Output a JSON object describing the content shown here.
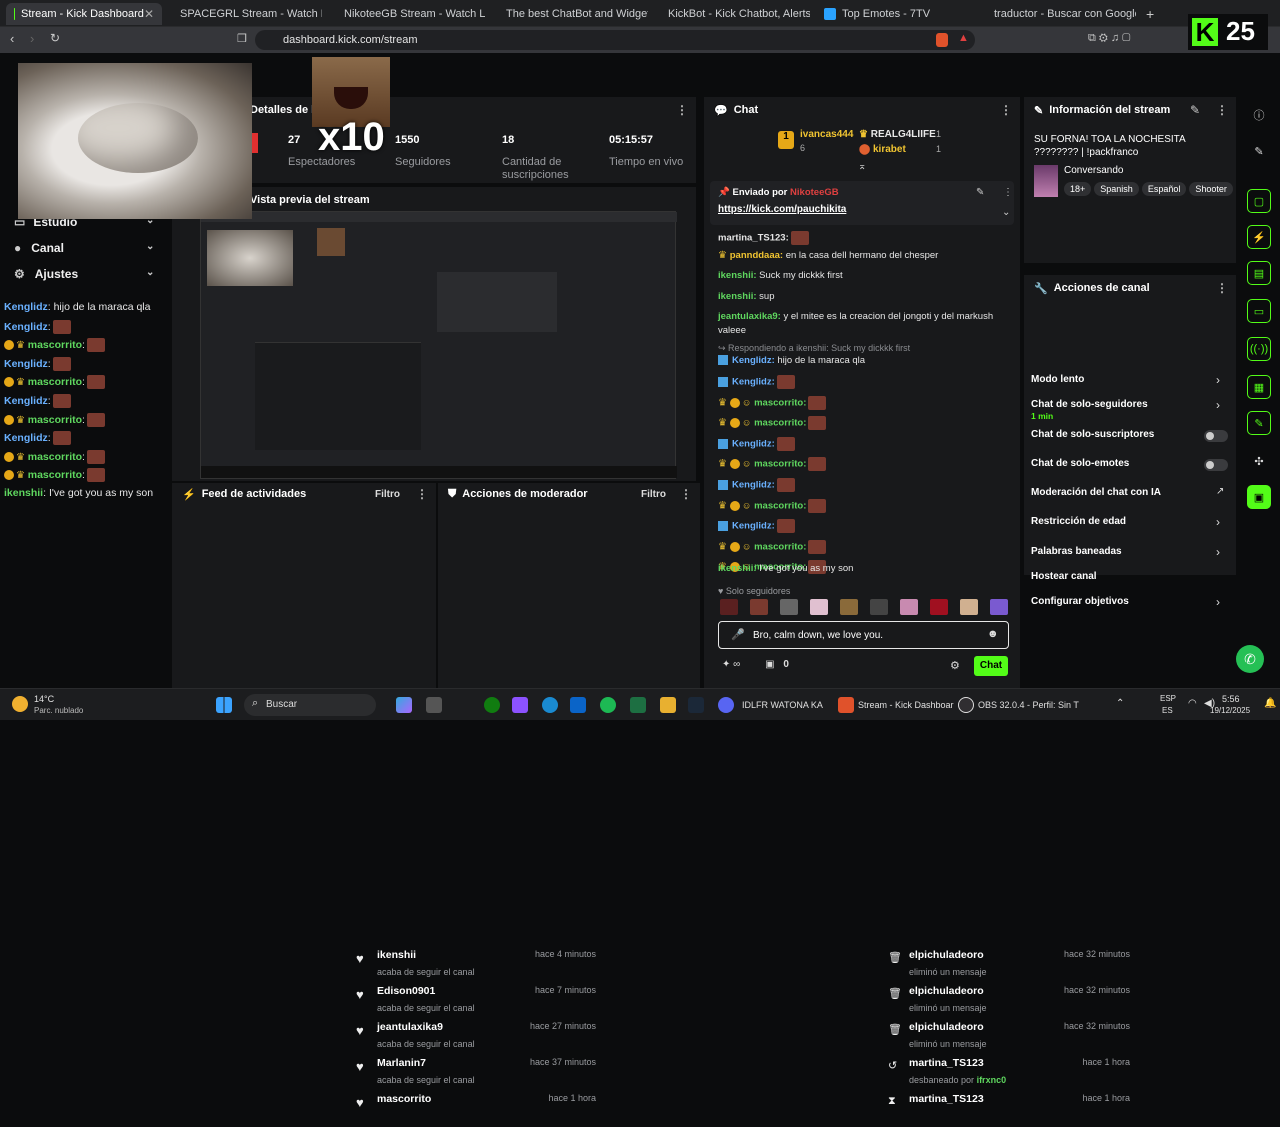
{
  "browser": {
    "tabs": [
      {
        "label": "Stream - Kick Dashboard",
        "color": "#53fc18"
      },
      {
        "label": "SPACEGRL Stream - Watch Live on K",
        "color": "#53fc18"
      },
      {
        "label": "NikoteeGB Stream - Watch Live on K",
        "color": "#53fc18"
      },
      {
        "label": "The best ChatBot and Widgets for K",
        "color": "#8e5cff"
      },
      {
        "label": "KickBot - Kick Chatbot, Alerts, TTS, C",
        "color": "#53fc18"
      },
      {
        "label": "Top Emotes - 7TV",
        "color": "#2aa3ff"
      },
      {
        "label": "traductor - Buscar con Google",
        "color": "#ffffff"
      }
    ],
    "url": "dashboard.kick.com/stream",
    "overlay_count": "25"
  },
  "overlay": {
    "x10": "x10"
  },
  "session": {
    "title": "Detalles de la sesión",
    "stats": [
      {
        "value": "27",
        "label": "Espectadores"
      },
      {
        "value": "1550",
        "label": "Seguidores"
      },
      {
        "value": "18",
        "label": "Cantidad de suscripciones"
      },
      {
        "value": "05:15:57",
        "label": "Tiempo en vivo"
      }
    ]
  },
  "stream_preview": {
    "title": "Vista previa del stream"
  },
  "left_nav": [
    {
      "label": "Estudio"
    },
    {
      "label": "Canal"
    },
    {
      "label": "Ajustes"
    }
  ],
  "left_chat": [
    {
      "user": "Kenglidz",
      "text": ": hijo de la maraca qla",
      "emote": false,
      "color": "#6ab1ff"
    },
    {
      "user": "Kenglidz",
      "text": ":",
      "emote": true,
      "color": "#6ab1ff"
    },
    {
      "user": "mascorrito",
      "text": ":",
      "emote": true,
      "color": "#5fd75f"
    },
    {
      "user": "Kenglidz",
      "text": ":",
      "emote": true,
      "color": "#6ab1ff"
    },
    {
      "user": "mascorrito",
      "text": ":",
      "emote": true,
      "color": "#5fd75f"
    },
    {
      "user": "Kenglidz",
      "text": ":",
      "emote": true,
      "color": "#6ab1ff"
    },
    {
      "user": "mascorrito",
      "text": ":",
      "emote": true,
      "color": "#5fd75f"
    },
    {
      "user": "Kenglidz",
      "text": ":",
      "emote": true,
      "color": "#6ab1ff"
    },
    {
      "user": "mascorrito",
      "text": ":",
      "emote": true,
      "color": "#5fd75f"
    },
    {
      "user": "mascorrito",
      "text": ":",
      "emote": true,
      "color": "#5fd75f"
    },
    {
      "user": "ikenshii",
      "text": ": I've got you as my son",
      "emote": false,
      "color": "#5fd75f"
    }
  ],
  "activity_feed": {
    "title": "Feed de actividades",
    "filter": "Filtro",
    "items": [
      {
        "user": "ikenshii",
        "desc": "acaba de seguir el canal",
        "time": "hace 4 minutos"
      },
      {
        "user": "Edison0901",
        "desc": "acaba de seguir el canal",
        "time": "hace 7 minutos"
      },
      {
        "user": "jeantulaxika9",
        "desc": "acaba de seguir el canal",
        "time": "hace 27 minutos"
      },
      {
        "user": "Marlanin7",
        "desc": "acaba de seguir el canal",
        "time": "hace 37 minutos"
      },
      {
        "user": "mascorrito",
        "desc": "",
        "time": "hace 1 hora"
      }
    ]
  },
  "mod_actions": {
    "title": "Acciones de moderador",
    "filter": "Filtro",
    "items": [
      {
        "user": "elpichuladeoro",
        "desc": "eliminó un mensaje",
        "time": "hace 32 minutos",
        "icon": "trash-icon"
      },
      {
        "user": "elpichuladeoro",
        "desc": "eliminó un mensaje",
        "time": "hace 32 minutos",
        "icon": "trash-icon"
      },
      {
        "user": "elpichuladeoro",
        "desc": "eliminó un mensaje",
        "time": "hace 32 minutos",
        "icon": "trash-icon"
      },
      {
        "user": "martina_TS123",
        "desc": "desbaneado por ",
        "by": "ifrxnc0",
        "time": "hace 1 hora",
        "icon": "undo-icon"
      },
      {
        "user": "martina_TS123",
        "desc": "",
        "time": "hace 1 hora",
        "icon": "hourglass-icon"
      }
    ]
  },
  "chat": {
    "title": "Chat",
    "top_gifters": [
      {
        "name": "ivancas444",
        "count": "6"
      },
      {
        "name": "REALG4LIIFE",
        "count": "1"
      },
      {
        "name": "kirabet",
        "count": "1"
      }
    ],
    "pinned": {
      "by_label": "Enviado por",
      "by_user": "NikoteeGB",
      "link": "https://kick.com/pauchikita"
    },
    "messages": [
      {
        "user": "martina_TS123:",
        "text": "",
        "color": "#e6e6e6"
      },
      {
        "user": "pannddaaa:",
        "text": " en la casa dell hermano del chesper",
        "color": "#f0c431"
      },
      {
        "user": "ikenshii:",
        "text": " Suck my dickkk first",
        "color": "#5fd75f"
      },
      {
        "user": "ikenshii:",
        "text": " sup",
        "color": "#5fd75f"
      },
      {
        "user": "jeantulaxika9:",
        "text": " y el mitee es la creacion del jongoti y del markush",
        "color": "#5fd75f"
      },
      {
        "user": "",
        "text": "valeee",
        "color": "#e6e6e6"
      }
    ],
    "reply_note": "Respondiendo a ikenshii: Suck my dickkk first",
    "reply_msg": {
      "user": "Kenglidz:",
      "text": " hijo de la maraca qla"
    },
    "emote_msgs": [
      {
        "user": "Kenglidz:",
        "color": "#6ab1ff"
      },
      {
        "user": "mascorrito:",
        "color": "#5fd75f"
      },
      {
        "user": "mascorrito:",
        "color": "#5fd75f"
      },
      {
        "user": "Kenglidz:",
        "color": "#6ab1ff"
      },
      {
        "user": "mascorrito:",
        "color": "#5fd75f"
      },
      {
        "user": "Kenglidz:",
        "color": "#6ab1ff"
      },
      {
        "user": "mascorrito:",
        "color": "#5fd75f"
      },
      {
        "user": "Kenglidz:",
        "color": "#6ab1ff"
      },
      {
        "user": "mascorrito:",
        "color": "#5fd75f"
      },
      {
        "user": "mascorrito:",
        "color": "#5fd75f"
      }
    ],
    "last_msg": {
      "user": "ikenshii:",
      "text": " I've got you as my son"
    },
    "followers_only": "Solo seguidores",
    "input_value": "Bro, calm down, we love you.",
    "points": "0",
    "send_label": "Chat"
  },
  "stream_info": {
    "title": "Información del stream",
    "stream_title": "SU FORNA! TOA LA NOCHESITA ???????? | !packfranco",
    "category": "Conversando",
    "tags": [
      "18+",
      "Spanish",
      "Español",
      "Shooter"
    ]
  },
  "channel_actions": {
    "title": "Acciones de canal",
    "items": [
      {
        "label": "Modo lento",
        "type": "chevron"
      },
      {
        "label": "Chat de solo-seguidores",
        "sub": "1 min",
        "type": "chevron"
      },
      {
        "label": "Chat de solo-suscriptores",
        "type": "toggle"
      },
      {
        "label": "Chat de solo-emotes",
        "type": "toggle"
      },
      {
        "label": "Moderación del chat con IA",
        "type": "external"
      },
      {
        "label": "Restricción de edad",
        "type": "chevron"
      },
      {
        "label": "Palabras baneadas",
        "type": "chevron"
      },
      {
        "label": "Hostear canal",
        "type": "none"
      },
      {
        "label": "Configurar objetivos",
        "type": "chevron"
      }
    ]
  },
  "taskbar": {
    "weather_temp": "14°C",
    "weather_desc": "Parc. nublado",
    "search": "Buscar",
    "apps": [
      "IDLFR WATONA KA",
      "Stream - Kick Dashboar",
      "OBS 32.0.4 - Perfil: Sin T"
    ],
    "lang1": "ESP",
    "lang2": "ES",
    "time": "5:56",
    "date": "19/12/2025"
  }
}
